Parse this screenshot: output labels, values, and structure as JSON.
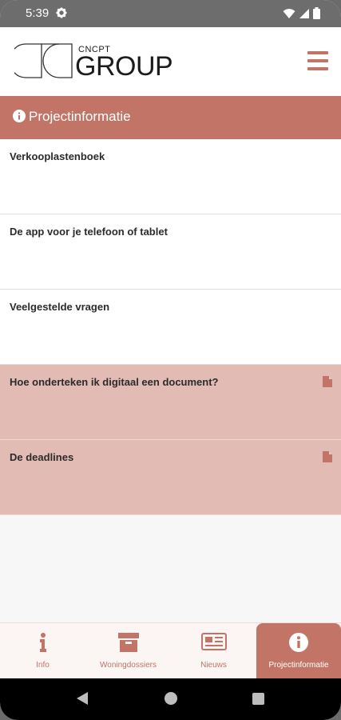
{
  "status_bar": {
    "time": "5:39",
    "icons": [
      "gear-icon",
      "wifi-icon",
      "signal-icon",
      "battery-icon"
    ]
  },
  "header": {
    "logo_small_text": "CNCPT",
    "logo_large_text": "GROUP",
    "menu_icon": "hamburger-menu-icon"
  },
  "section": {
    "title": "Projectinformatie",
    "icon": "info-circle-icon"
  },
  "items": [
    {
      "title": "Verkooplastenboek",
      "has_document": false
    },
    {
      "title": "De app voor je telefoon of tablet",
      "has_document": false
    },
    {
      "title": "Veelgestelde vragen",
      "has_document": false
    },
    {
      "title": "Hoe onderteken ik digitaal een document?",
      "has_document": true
    },
    {
      "title": "De deadlines",
      "has_document": true
    }
  ],
  "tabs": [
    {
      "label": "Info",
      "icon": "info-icon",
      "active": false
    },
    {
      "label": "Woningdossiers",
      "icon": "archive-box-icon",
      "active": false
    },
    {
      "label": "Nieuws",
      "icon": "newspaper-icon",
      "active": false
    },
    {
      "label": "Projectinformatie",
      "icon": "info-circle-icon",
      "active": true
    }
  ],
  "colors": {
    "accent": "#c27566",
    "highlight_row": "#e2bcb4",
    "status_bar": "#6d6d6d"
  }
}
